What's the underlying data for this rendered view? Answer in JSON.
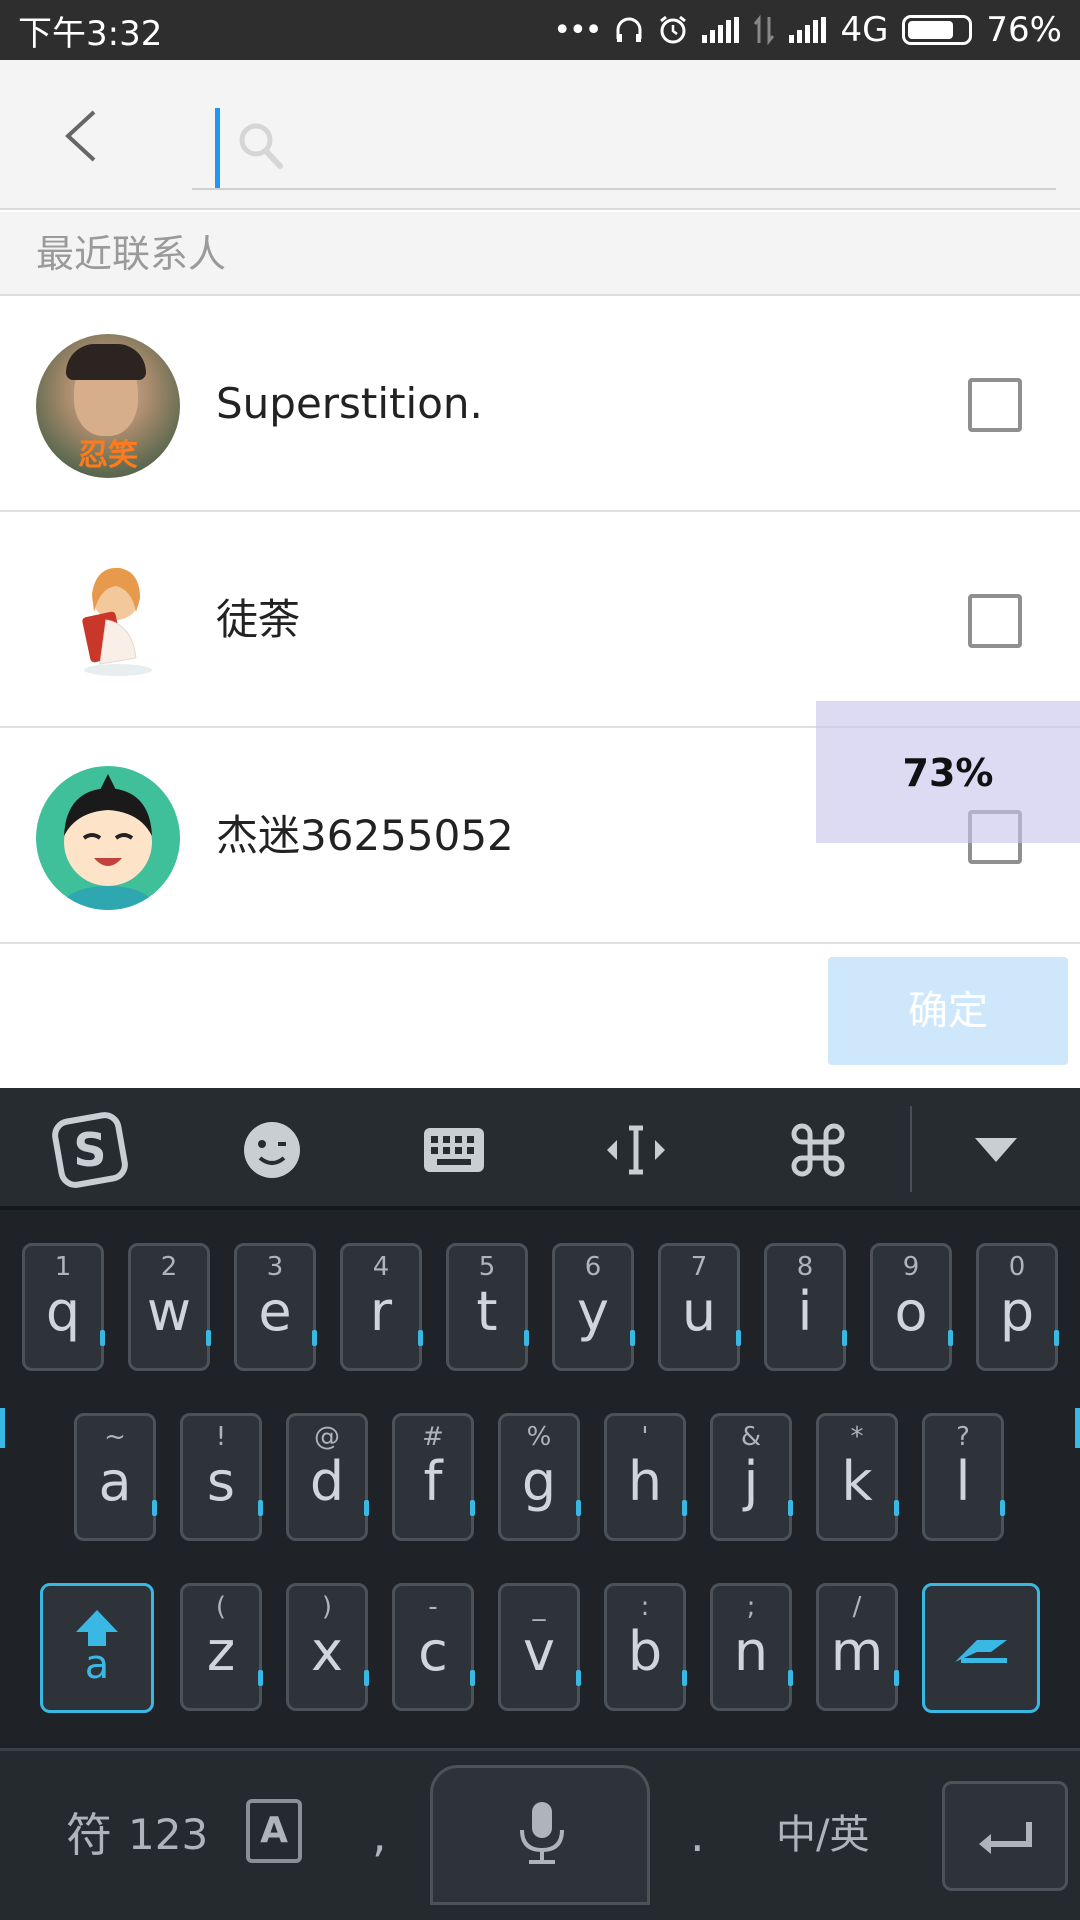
{
  "status_bar": {
    "time": "下午3:32",
    "network": "4G",
    "battery": "76%",
    "battery_level": 0.76
  },
  "search": {
    "value": "",
    "placeholder": ""
  },
  "section_title": "最近联系人",
  "contacts": [
    {
      "name": "Superstition.",
      "avatar_caption": "忍笑",
      "checked": false
    },
    {
      "name": "徒荼",
      "checked": false
    },
    {
      "name": "杰迷36255052",
      "checked": false
    }
  ],
  "overlay_percent": "73%",
  "confirm_label": "确定",
  "colors": {
    "accent": "#2196f3",
    "confirm_bg": "#cfe7fb",
    "keyboard_bg": "#1f2327",
    "keyboard_glow": "#3ab8e4"
  },
  "keyboard": {
    "toolbar": [
      "sogou-logo-icon",
      "emoji-icon",
      "keyboard-icon",
      "cursor-move-icon",
      "command-icon",
      "collapse-icon"
    ],
    "row1": [
      {
        "main": "q",
        "sub": "1"
      },
      {
        "main": "w",
        "sub": "2"
      },
      {
        "main": "e",
        "sub": "3"
      },
      {
        "main": "r",
        "sub": "4"
      },
      {
        "main": "t",
        "sub": "5"
      },
      {
        "main": "y",
        "sub": "6"
      },
      {
        "main": "u",
        "sub": "7"
      },
      {
        "main": "i",
        "sub": "8"
      },
      {
        "main": "o",
        "sub": "9"
      },
      {
        "main": "p",
        "sub": "0"
      }
    ],
    "row2": [
      {
        "main": "a",
        "sub": "~"
      },
      {
        "main": "s",
        "sub": "!"
      },
      {
        "main": "d",
        "sub": "@"
      },
      {
        "main": "f",
        "sub": "#"
      },
      {
        "main": "g",
        "sub": "%"
      },
      {
        "main": "h",
        "sub": "'"
      },
      {
        "main": "j",
        "sub": "&"
      },
      {
        "main": "k",
        "sub": "*"
      },
      {
        "main": "l",
        "sub": "?"
      }
    ],
    "row3": [
      {
        "main": "z",
        "sub": "("
      },
      {
        "main": "x",
        "sub": ")"
      },
      {
        "main": "c",
        "sub": "-"
      },
      {
        "main": "v",
        "sub": "_"
      },
      {
        "main": "b",
        "sub": ":"
      },
      {
        "main": "n",
        "sub": ";"
      },
      {
        "main": "m",
        "sub": "/"
      }
    ],
    "shift_label": "a",
    "symbol_label": "符",
    "number_label": "123",
    "comma_label": ",",
    "period_label": ".",
    "lang_label": "中/英"
  }
}
